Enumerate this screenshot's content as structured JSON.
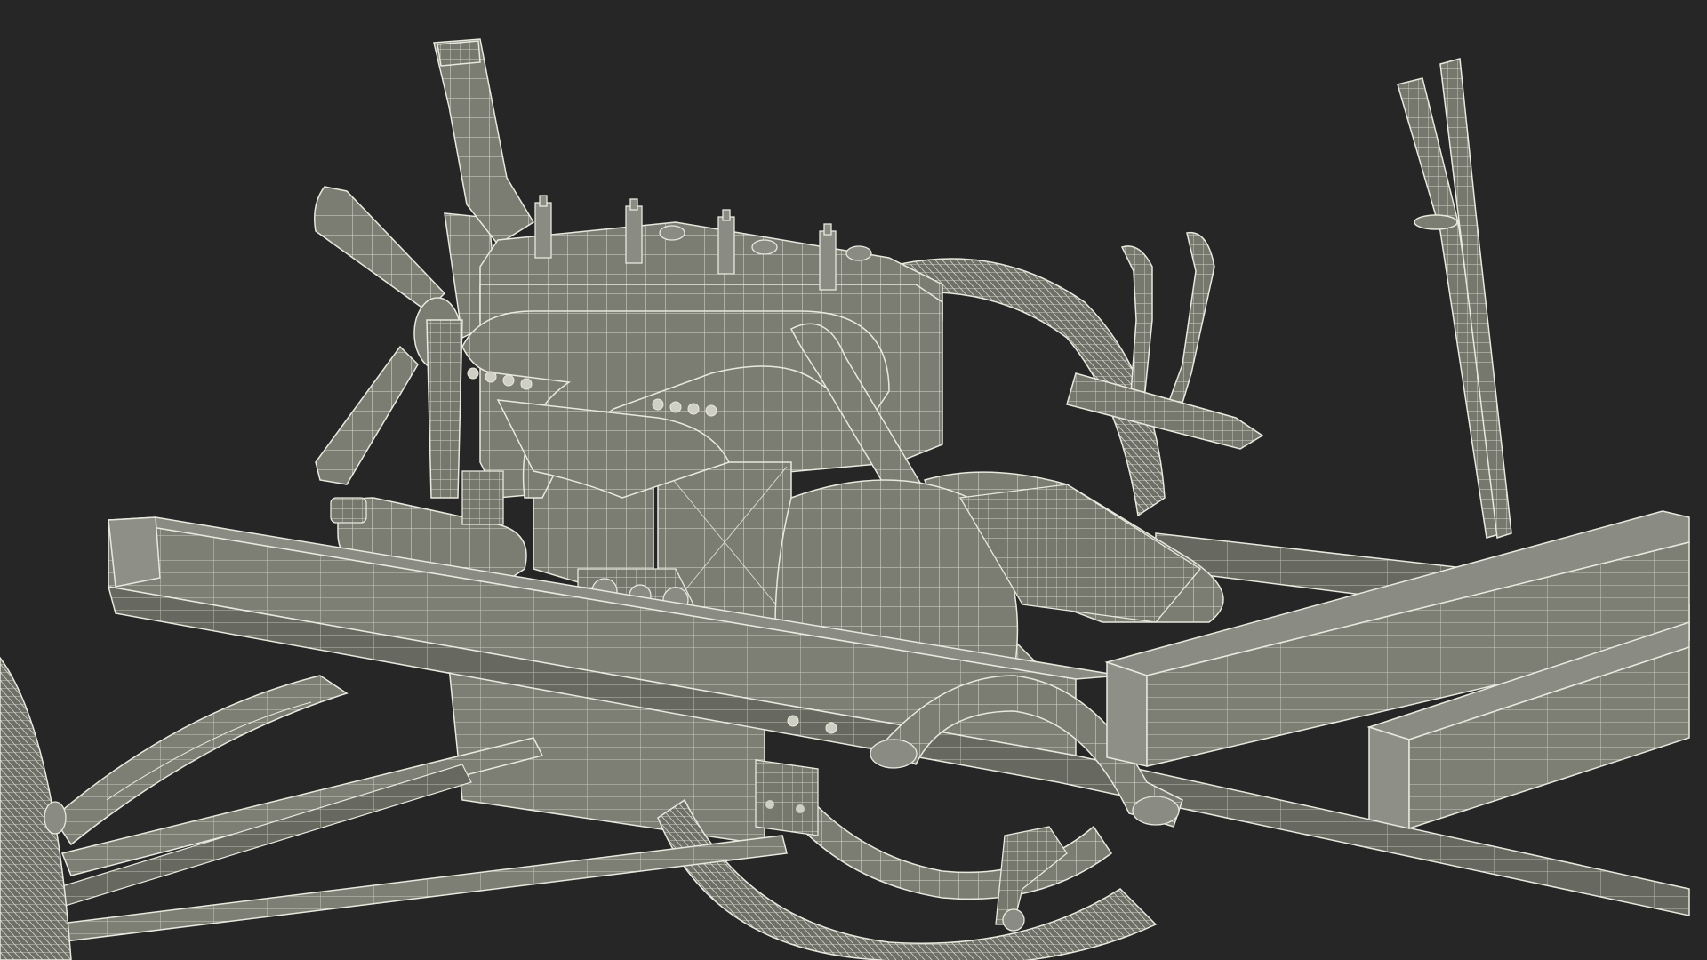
{
  "scene": {
    "background_color": "#262626",
    "model_fill": "#7b7c72",
    "model_shade": "#676860",
    "model_dark": "#55564f",
    "wire_color": "#e8e8de",
    "subject": "engine-chassis-wireframe-render"
  }
}
